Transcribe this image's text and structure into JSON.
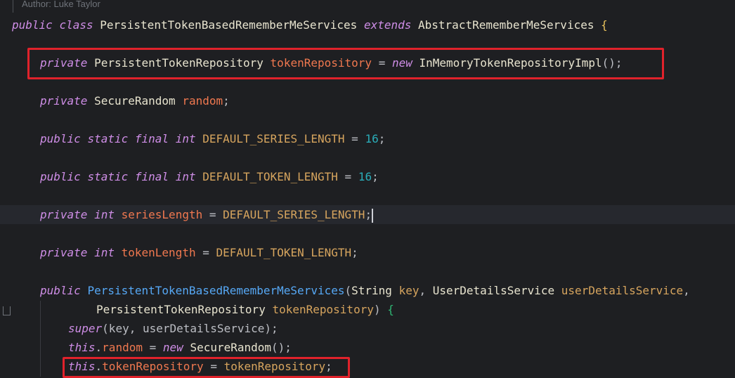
{
  "header": {
    "author": "Author: Luke Taylor"
  },
  "code": {
    "l1": {
      "kw1": "public",
      "kw2": "class",
      "name": "PersistentTokenBasedRememberMeServices",
      "kw3": "extends",
      "base": "AbstractRememberMeServices",
      "brace": "{"
    },
    "l2": {
      "kw": "private",
      "type": "PersistentTokenRepository",
      "field": "tokenRepository",
      "eq": "=",
      "new": "new",
      "ctor": "InMemoryTokenRepositoryImpl",
      "end": "();"
    },
    "l3": {
      "kw": "private",
      "type": "SecureRandom",
      "field": "random",
      "end": ";"
    },
    "l4": {
      "kw1": "public",
      "kw2": "static",
      "kw3": "final",
      "kw4": "int",
      "name": "DEFAULT_SERIES_LENGTH",
      "eq": "=",
      "val": "16",
      "end": ";"
    },
    "l5": {
      "kw1": "public",
      "kw2": "static",
      "kw3": "final",
      "kw4": "int",
      "name": "DEFAULT_TOKEN_LENGTH",
      "eq": "=",
      "val": "16",
      "end": ";"
    },
    "l6": {
      "kw1": "private",
      "kw2": "int",
      "field": "seriesLength",
      "eq": "=",
      "val": "DEFAULT_SERIES_LENGTH",
      "end": ";"
    },
    "l7": {
      "kw1": "private",
      "kw2": "int",
      "field": "tokenLength",
      "eq": "=",
      "val": "DEFAULT_TOKEN_LENGTH",
      "end": ";"
    },
    "l8": {
      "kw": "public",
      "name": "PersistentTokenBasedRememberMeServices",
      "open": "(",
      "t1": "String",
      "p1": "key",
      "c1": ",",
      "t2": "UserDetailsService",
      "p2": "userDetailsService",
      "c2": ","
    },
    "l9": {
      "t3": "PersistentTokenRepository",
      "p3": "tokenRepository",
      "close": ")",
      "brace": "{"
    },
    "l10": {
      "kw": "super",
      "args": "(key, userDetailsService);"
    },
    "l11": {
      "kw": "this",
      "dot": ".",
      "field": "random",
      "eq": "=",
      "new": "new",
      "ctor": "SecureRandom",
      "end": "();"
    },
    "l12": {
      "kw": "this",
      "dot": ".",
      "field": "tokenRepository",
      "eq": "=",
      "val": "tokenRepository",
      "end": ";"
    }
  },
  "colors": {
    "highlight": "#e0222b",
    "background": "#1e1f22"
  }
}
